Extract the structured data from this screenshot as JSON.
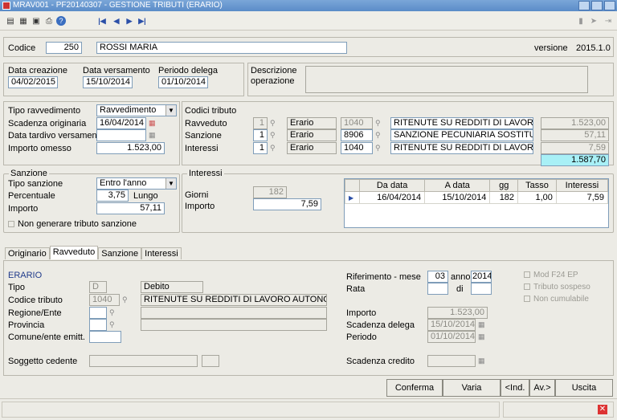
{
  "window": {
    "title": "MRAV001 - PF20140307 - GESTIONE TRIBUTI (ERARIO)"
  },
  "header": {
    "codice_label": "Codice",
    "codice": "250",
    "name": "ROSSI MARIA",
    "versione_label": "versione",
    "versione": "2015.1.0"
  },
  "dates": {
    "creazione_label": "Data creazione",
    "creazione": "04/02/2015",
    "versamento_label": "Data versamento",
    "versamento": "15/10/2014",
    "periodo_label": "Periodo delega",
    "periodo": "01/10/2014",
    "descrizione_label": "Descrizione operazione",
    "descrizione": ""
  },
  "ravvedimento": {
    "tipo_label": "Tipo ravvedimento",
    "tipo": "Ravvedimento",
    "scadenza_label": "Scadenza originaria",
    "scadenza": "16/04/2014",
    "tardivo_label": "Data tardivo versamento",
    "tardivo": "",
    "importo_label": "Importo omesso",
    "importo": "1.523,00"
  },
  "codici": {
    "title": "Codici tributo",
    "rows": [
      {
        "label": "Ravveduto",
        "qty": "1",
        "ente": "Erario",
        "code": "1040",
        "desc": "RITENUTE SU REDDITI DI LAVORO AUT",
        "amount": "1.523,00"
      },
      {
        "label": "Sanzione",
        "qty": "1",
        "ente": "Erario",
        "code": "8906",
        "desc": "SANZIONE PECUNIARIA SOSTITUTI DI",
        "amount": "57,11"
      },
      {
        "label": "Interessi",
        "qty": "1",
        "ente": "Erario",
        "code": "1040",
        "desc": "RITENUTE SU REDDITI DI LAVORO AUT",
        "amount": "7,59"
      }
    ],
    "total": "1.587,70"
  },
  "sanzione": {
    "title": "Sanzione",
    "tipo_label": "Tipo sanzione",
    "tipo": "Entro l'anno",
    "perc_label": "Percentuale",
    "perc": "3,75",
    "perc_suffix": "Lungo",
    "importo_label": "Importo",
    "importo": "57,11",
    "no_gen_label": "Non generare tributo sanzione"
  },
  "interessi": {
    "title": "Interessi",
    "giorni_label": "Giorni",
    "giorni": "182",
    "importo_label": "Importo",
    "importo": "7,59",
    "grid": {
      "headers": [
        "Da data",
        "A data",
        "gg",
        "Tasso",
        "Interessi"
      ],
      "rows": [
        [
          "16/04/2014",
          "15/10/2014",
          "182",
          "1,00",
          "7,59"
        ]
      ]
    }
  },
  "tabs": [
    "Originario",
    "Ravveduto",
    "Sanzione",
    "Interessi"
  ],
  "detail": {
    "section": "ERARIO",
    "tipo_label": "Tipo",
    "tipo_code": "D",
    "tipo_desc": "Debito",
    "codice_label": "Codice tributo",
    "codice": "1040",
    "codice_desc": "RITENUTE SU REDDITI DI LAVORO AUTONOMO CO",
    "regione_label": "Regione/Ente",
    "provincia_label": "Provincia",
    "comune_label": "Comune/ente emitt.",
    "soggetto_label": "Soggetto cedente",
    "rif_label": "Riferimento - mese",
    "rif_mese": "03",
    "anno_label": "anno",
    "anno": "2014",
    "rata_label": "Rata",
    "di_label": "di",
    "importo_label": "Importo",
    "importo": "1.523,00",
    "scad_delega_label": "Scadenza delega",
    "scad_delega": "15/10/2014",
    "periodo_label": "Periodo",
    "periodo": "01/10/2014",
    "scad_credito_label": "Scadenza credito",
    "mod_label": "Mod F24 EP",
    "sospeso_label": "Tributo sospeso",
    "cumulabile_label": "Non cumulabile"
  },
  "buttons": {
    "conferma": "Conferma",
    "varia": "Varia",
    "ind": "<Ind.",
    "av": "Av.>",
    "uscita": "Uscita"
  }
}
